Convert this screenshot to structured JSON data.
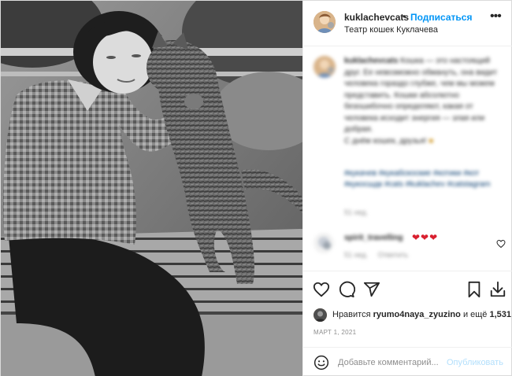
{
  "header": {
    "username": "kuklachevcats",
    "separator": "•",
    "follow_label": "Подписаться",
    "subtitle": "Театр кошек Куклачева",
    "more_icon": "more-icon"
  },
  "caption": {
    "username": "kuklachevcats",
    "text": "Кошка — это настоящий друг. Ее невозможно обмануть, она видит человека гораздо глубже, чем мы можем представить. Кошки абсолютно безошибочно определяют, какая от человека исходит энергия — злая или добрая.",
    "greeting": "С днём кошек, друзья!",
    "tags": "#кукачев #кукабскоские #котики #кот #кукосшдк #cats #kuklachev #catstagram",
    "time_ago": "51 нед."
  },
  "comment": {
    "username": "spirit_travelling",
    "hearts": "❤❤❤",
    "time_ago": "51 нед.",
    "reply_label": "Ответить"
  },
  "likes": {
    "prefix": "Нравится",
    "user": "ryumo4naya_zyuzino",
    "middle": "и ещё",
    "count": "1,531"
  },
  "date": "МАРТ 1, 2021",
  "comment_input": {
    "placeholder": "Добавьте комментарий...",
    "publish_label": "Опубликовать"
  },
  "colors": {
    "link_blue": "#0095f6",
    "publish_disabled": "#b2dffc",
    "heart_red": "#d9202f",
    "tag_blue": "#00376b"
  }
}
